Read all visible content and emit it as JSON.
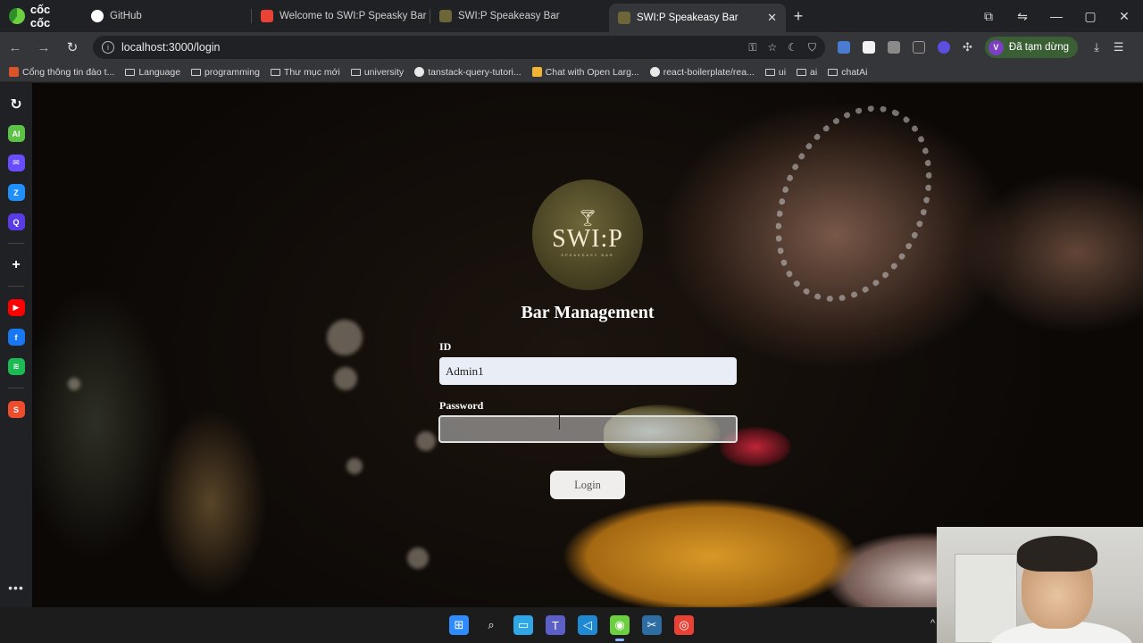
{
  "browser": {
    "brand": "cốc cốc",
    "tabs": [
      {
        "label": "GitHub",
        "color": "#ffffff"
      },
      {
        "label": "Welcome to SWI:P Speasky Bar - ...",
        "color": "#ea4335"
      },
      {
        "label": "SWI:P Speakeasy Bar",
        "color": "#6d6638"
      },
      {
        "label": "SWI:P Speakeasy Bar",
        "color": "#6d6638",
        "active": true
      }
    ],
    "new_tab_glyph": "+",
    "url": "localhost:3000/login",
    "profile_initial": "V",
    "profile_label": "Đã tạm dừng",
    "bookmarks": [
      {
        "label": "Cổng thông tin đào t...",
        "icon": "favicon-icon"
      },
      {
        "label": "Language",
        "icon": "folder-icon"
      },
      {
        "label": "programming",
        "icon": "folder-icon"
      },
      {
        "label": "Thư mục mới",
        "icon": "folder-icon"
      },
      {
        "label": "university",
        "icon": "folder-icon"
      },
      {
        "label": "tanstack-query-tutori...",
        "icon": "github-icon"
      },
      {
        "label": "Chat with Open Larg...",
        "icon": "favicon-icon"
      },
      {
        "label": "react-boilerplate/rea...",
        "icon": "github-icon"
      },
      {
        "label": "ui",
        "icon": "folder-icon"
      },
      {
        "label": "ai",
        "icon": "folder-icon"
      },
      {
        "label": "chatAi",
        "icon": "folder-icon"
      }
    ]
  },
  "sidebar_apps": [
    {
      "name": "history-icon",
      "color": "#202124",
      "glyph": "↻"
    },
    {
      "name": "ai-icon",
      "color": "#5cc246",
      "glyph": "AI"
    },
    {
      "name": "messenger-icon",
      "color": "#6a4cff",
      "glyph": "✉"
    },
    {
      "name": "zalo-icon",
      "color": "#1e8ffb",
      "glyph": "Z"
    },
    {
      "name": "assistant-icon",
      "color": "#5a3ce6",
      "glyph": "Q"
    },
    {
      "name": "add-icon",
      "color": "#202124",
      "glyph": "+"
    },
    {
      "name": "youtube-icon",
      "color": "#ff0000",
      "glyph": "▶"
    },
    {
      "name": "facebook-icon",
      "color": "#1877f2",
      "glyph": "f"
    },
    {
      "name": "spotify-icon",
      "color": "#1db954",
      "glyph": "≋"
    },
    {
      "name": "shopee-icon",
      "color": "#ee4d2d",
      "glyph": "S"
    }
  ],
  "login": {
    "logo_text": "SWI:P",
    "logo_subtitle": "SPEAKEASY BAR",
    "title": "Bar Management",
    "id_label": "ID",
    "id_value": "Admin1",
    "password_label": "Password",
    "password_value": "",
    "login_button": "Login"
  },
  "taskbar_icons": [
    {
      "name": "windows-start-icon",
      "color": "#2f8cff",
      "glyph": "⊞"
    },
    {
      "name": "search-icon",
      "color": "#1c1c1c",
      "glyph": "⌕"
    },
    {
      "name": "desktop-icon",
      "color": "#2fa7e6",
      "glyph": "▭"
    },
    {
      "name": "teams-icon",
      "color": "#5b5fc7",
      "glyph": "T"
    },
    {
      "name": "vscode-icon",
      "color": "#1f8ad2",
      "glyph": "◁"
    },
    {
      "name": "coccoc-browser-icon",
      "color": "#6ccf3f",
      "glyph": "◉",
      "active": true
    },
    {
      "name": "snipping-tool-icon",
      "color": "#2e6da4",
      "glyph": "✂"
    },
    {
      "name": "chrome-icon",
      "color": "#e94235",
      "glyph": "◎"
    }
  ]
}
